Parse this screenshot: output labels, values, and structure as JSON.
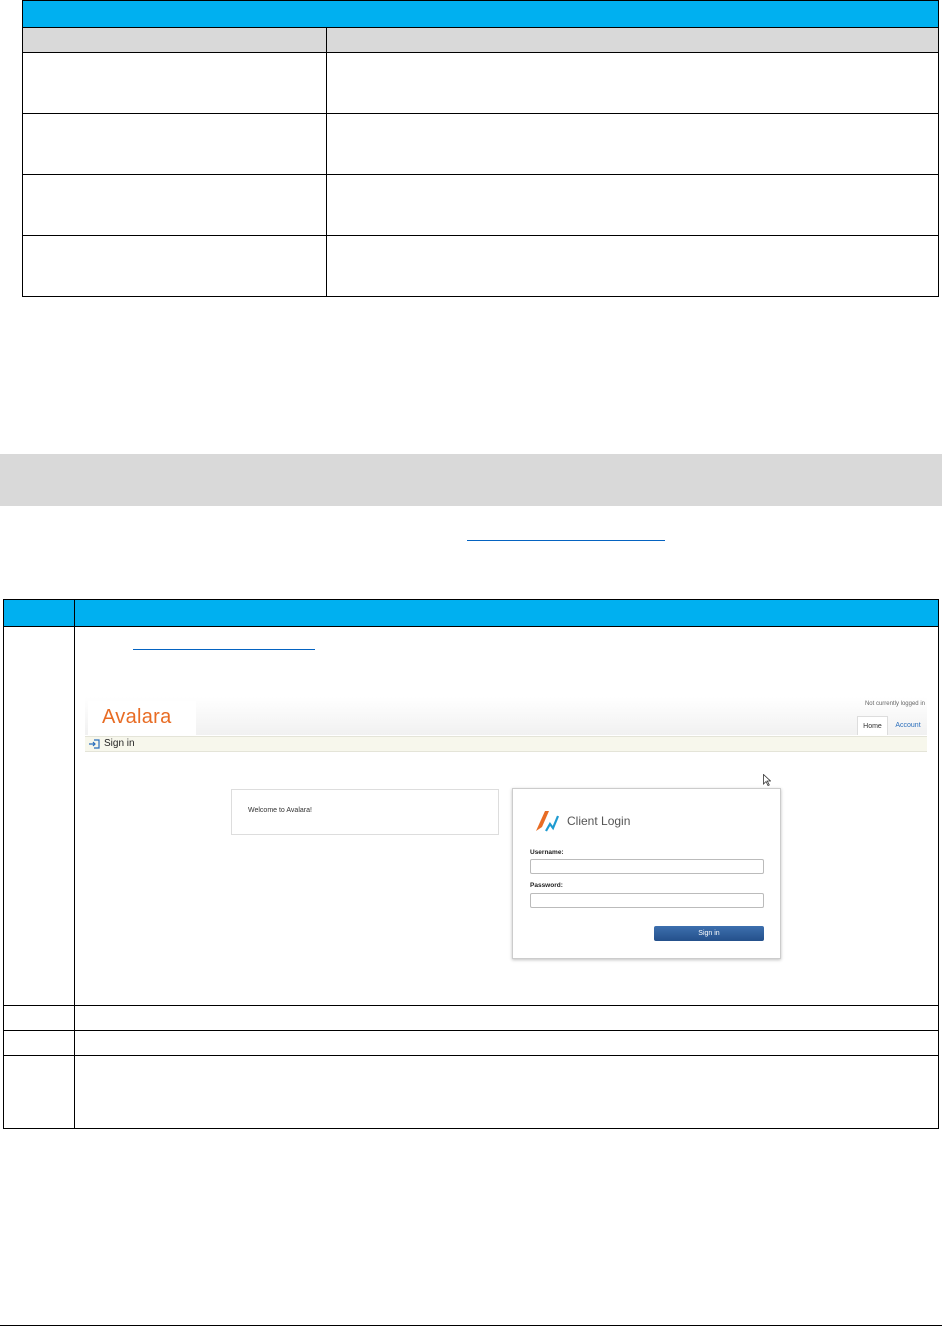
{
  "shot": {
    "logo_text": "Avalara",
    "status_text": "Not currently logged in",
    "tabs": [
      {
        "label": "Home"
      },
      {
        "label": "Account"
      }
    ],
    "signin_bar_label": "Sign in",
    "welcome_text": "Welcome to Avalara!",
    "login": {
      "title": "Client Login",
      "username_label": "Username:",
      "password_label": "Password:",
      "button_label": "Sign in"
    }
  },
  "colors": {
    "table_header": "#00b0f0",
    "column_header": "#d9d9d9",
    "section_band": "#d9d9d9",
    "link": "#0563c1",
    "avalara_orange": "#e86c24",
    "button_blue": "#2a5a99"
  }
}
